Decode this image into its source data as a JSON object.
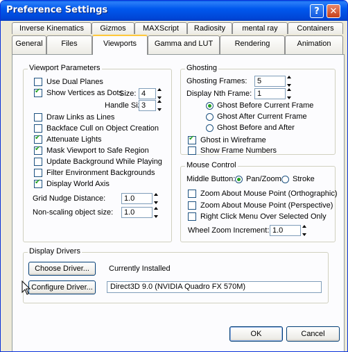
{
  "window": {
    "title": "Preference Settings",
    "help_label": "?",
    "close_label": "✕"
  },
  "tabs_row1": [
    "Inverse Kinematics",
    "Gizmos",
    "MAXScript",
    "Radiosity",
    "mental ray",
    "Containers"
  ],
  "tabs_row2": [
    "General",
    "Files",
    "Viewports",
    "Gamma and LUT",
    "Rendering",
    "Animation"
  ],
  "active_tab": "Viewports",
  "viewport_parameters": {
    "legend": "Viewport Parameters",
    "use_dual_planes": {
      "label": "Use Dual Planes",
      "checked": false
    },
    "show_vertices": {
      "label": "Show Vertices as Dots",
      "checked": true
    },
    "size_label": "Size:",
    "size_value": "4",
    "handle_size_label": "Handle Size:",
    "handle_size_value": "3",
    "draw_links": {
      "label": "Draw Links as Lines",
      "checked": false
    },
    "backface_cull": {
      "label": "Backface Cull on Object Creation",
      "checked": false
    },
    "attenuate_lights": {
      "label": "Attenuate Lights",
      "checked": true
    },
    "mask_viewport": {
      "label": "Mask Viewport to Safe Region",
      "checked": true
    },
    "update_background": {
      "label": "Update Background While Playing",
      "checked": false
    },
    "filter_env": {
      "label": "Filter Environment Backgrounds",
      "checked": false
    },
    "display_world_axis": {
      "label": "Display World Axis",
      "checked": true
    },
    "grid_nudge_label": "Grid Nudge Distance:",
    "grid_nudge_value": "1.0",
    "nonscaling_label": "Non-scaling object size:",
    "nonscaling_value": "1.0"
  },
  "ghosting": {
    "legend": "Ghosting",
    "frames_label": "Ghosting Frames:",
    "frames_value": "5",
    "nth_label": "Display Nth Frame:",
    "nth_value": "1",
    "before_current": {
      "label": "Ghost Before Current Frame",
      "selected": true
    },
    "after_current": {
      "label": "Ghost After Current Frame",
      "selected": false
    },
    "before_after": {
      "label": "Ghost Before and After",
      "selected": false
    },
    "in_wireframe": {
      "label": "Ghost in Wireframe",
      "checked": true
    },
    "show_frame_numbers": {
      "label": "Show Frame Numbers",
      "checked": false
    }
  },
  "mouse_control": {
    "legend": "Mouse Control",
    "middle_button_label": "Middle Button:",
    "pan_zoom": {
      "label": "Pan/Zoom",
      "selected": true
    },
    "stroke": {
      "label": "Stroke",
      "selected": false
    },
    "zoom_ortho": {
      "label": "Zoom About Mouse Point (Orthographic)",
      "checked": false
    },
    "zoom_persp": {
      "label": "Zoom About Mouse Point (Perspective)",
      "checked": false
    },
    "right_click": {
      "label": "Right Click Menu Over Selected Only",
      "checked": false
    },
    "wheel_zoom_label": "Wheel Zoom Increment:",
    "wheel_zoom_value": "1.0"
  },
  "display_drivers": {
    "legend": "Display Drivers",
    "choose_driver": "Choose Driver...",
    "currently_installed": "Currently Installed",
    "configure_driver": "Configure Driver...",
    "driver_value": "Direct3D 9.0 (NVIDIA Quadro FX 570M)"
  },
  "footer": {
    "ok": "OK",
    "cancel": "Cancel"
  },
  "colors": {
    "title_bar": "#0058ee",
    "window_bg": "#ece9d8",
    "panel_bg": "#fcfcfe",
    "check": "#21a121",
    "active_tab_accent": "#ffc83c"
  }
}
